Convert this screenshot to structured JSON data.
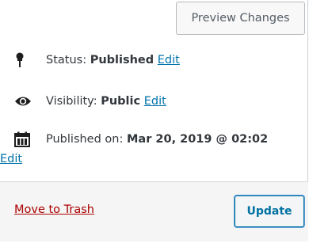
{
  "toolbar": {
    "preview_label": "Preview Changes"
  },
  "status": {
    "label": "Status:",
    "value": "Published",
    "edit": "Edit",
    "icon": "pin-icon"
  },
  "visibility": {
    "label": "Visibility:",
    "value": "Public",
    "edit": "Edit",
    "icon": "eye-icon"
  },
  "published": {
    "label": "Published on:",
    "value": "Mar 20, 2019 @ 02:02",
    "edit": "Edit",
    "icon": "calendar-icon"
  },
  "footer": {
    "trash_label": "Move to Trash",
    "update_label": "Update"
  },
  "colors": {
    "link": "#0073aa",
    "danger": "#a00",
    "primary": "#0071a1"
  }
}
